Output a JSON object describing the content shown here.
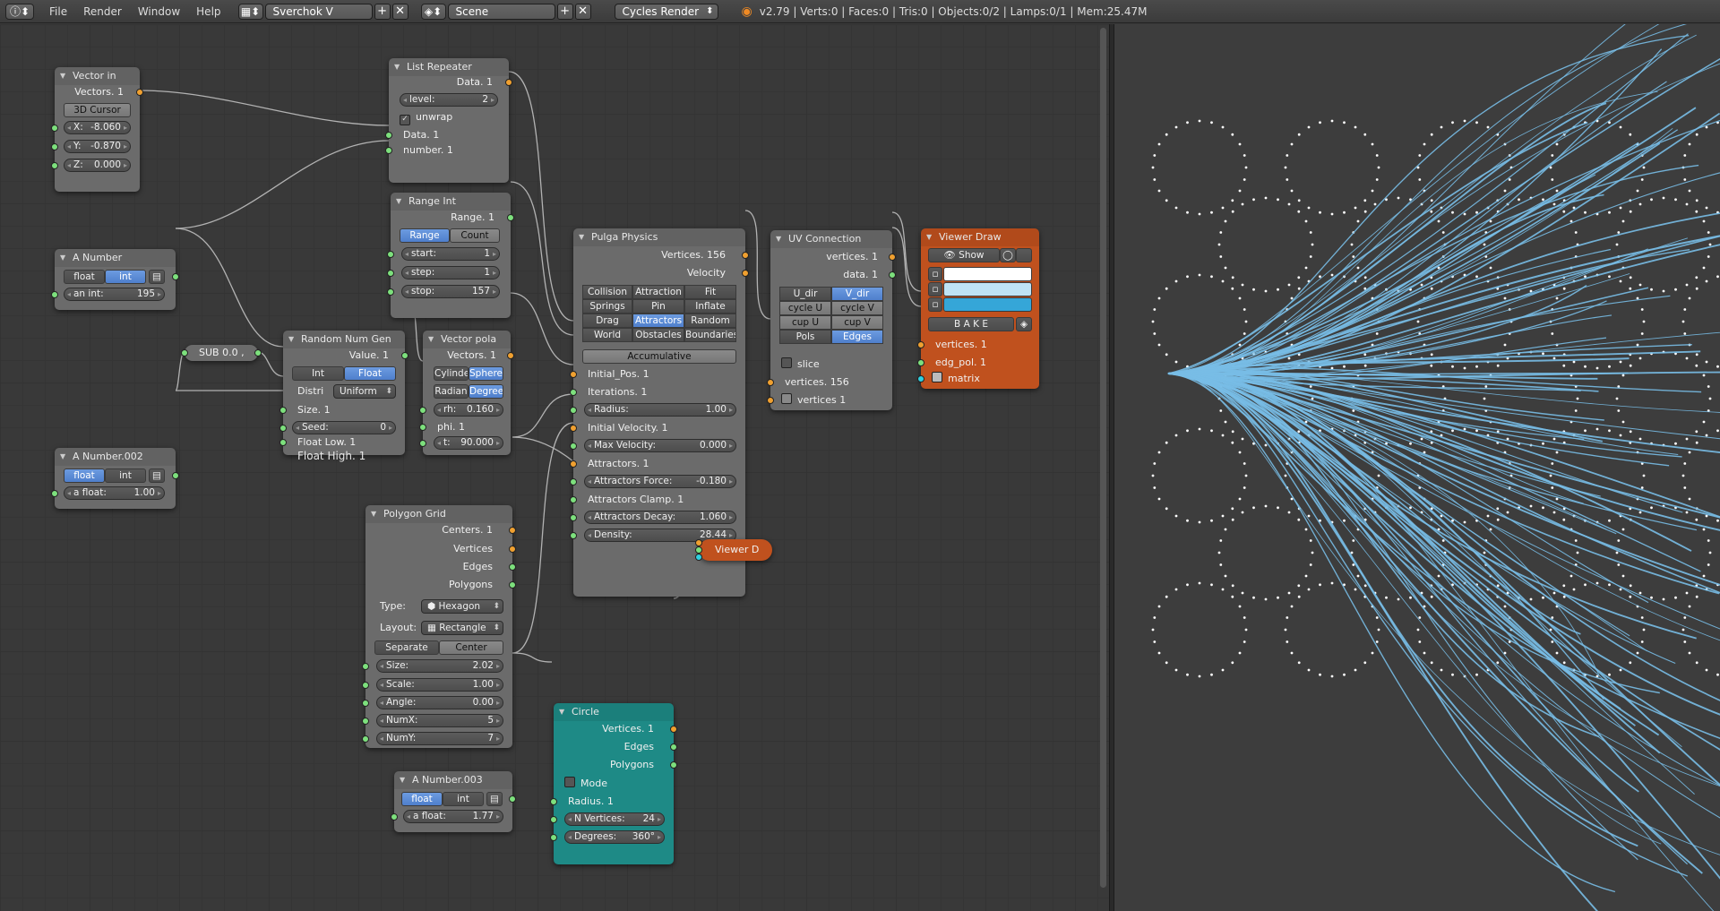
{
  "topbar": {
    "info_icon": "info-icon",
    "menus": [
      "File",
      "Render",
      "Window",
      "Help"
    ],
    "screen_name": "Sverchok V",
    "scene_name": "Scene",
    "render_engine": "Cycles Render",
    "stats": "v2.79 | Verts:0 | Faces:0 | Tris:0 | Objects:0/2 | Lamps:0/1 | Mem:25.47M"
  },
  "nodes": {
    "vector_in": {
      "title": "Vector in",
      "out_vectors": "Vectors. 1",
      "btn_cursor": "3D Cursor",
      "x_label": "X:",
      "x_val": "-8.060",
      "y_label": "Y:",
      "y_val": "-0.870",
      "z_label": "Z:",
      "z_val": "0.000"
    },
    "list_repeater": {
      "title": "List Repeater",
      "out_data": "Data. 1",
      "level_label": "level:",
      "level_val": "2",
      "unwrap": "unwrap",
      "in_data": "Data. 1",
      "in_number": "number. 1"
    },
    "range_int": {
      "title": "Range Int",
      "out_range": "Range. 1",
      "btn_range": "Range",
      "btn_count": "Count",
      "start_label": "start:",
      "start_val": "1",
      "step_label": "step:",
      "step_val": "1",
      "stop_label": "stop:",
      "stop_val": "157"
    },
    "a_number": {
      "title": "A Number",
      "btn_float": "float",
      "btn_int": "int",
      "int_label": "an int:",
      "int_val": "195"
    },
    "random_num_gen": {
      "title": "Random Num Gen",
      "out_value": "Value. 1",
      "btn_int": "Int",
      "btn_float": "Float",
      "distri_label": "Distri",
      "distri_val": "Uniform",
      "in_size": "Size. 1",
      "seed_label": "Seed:",
      "seed_val": "0",
      "in_flow": "Float Low. 1",
      "in_fhigh": "Float High. 1"
    },
    "vector_polar": {
      "title": "Vector pola",
      "out_vectors": "Vectors. 1",
      "btn_cyl": "Cylinde",
      "btn_sph": "Sphere",
      "btn_rad": "Radian",
      "btn_deg": "Degree",
      "rh_label": "rh:",
      "rh_val": "0.160",
      "in_phi": "phi. 1",
      "t_label": "t:",
      "t_val": "90.000"
    },
    "sub": {
      "title": "SUB 0.0 ,"
    },
    "a_number_002": {
      "title": "A Number.002",
      "btn_float": "float",
      "btn_int": "int",
      "float_label": "a float:",
      "float_val": "1.00"
    },
    "pulga": {
      "title": "Pulga Physics",
      "out_vertices": "Vertices. 156",
      "out_velocity": "Velocity",
      "grid": [
        "Collision",
        "Attraction",
        "Fit",
        "Springs",
        "Pin",
        "Inflate",
        "Drag",
        "Attractors",
        "Random",
        "World",
        "Obstacles",
        "Boundaries"
      ],
      "accumulative": "Accumulative",
      "in_initial_pos": "Initial_Pos. 1",
      "in_iterations": "Iterations. 1",
      "radius_label": "Radius:",
      "radius_val": "1.00",
      "in_initial_vel": "Initial Velocity. 1",
      "maxvel_label": "Max Velocity:",
      "maxvel_val": "0.000",
      "in_attractors": "Attractors. 1",
      "attforce_label": "Attractors Force:",
      "attforce_val": "-0.180",
      "in_attclamp": "Attractors Clamp. 1",
      "attdecay_label": "Attractors Decay:",
      "attdecay_val": "1.060",
      "density_label": "Density:",
      "density_val": "28.44"
    },
    "uv_connection": {
      "title": "UV Connection",
      "out_vertices": "vertices. 1",
      "out_data": "data. 1",
      "grid": [
        "U_dir",
        "V_dir",
        "cycle U",
        "cycle V",
        "cup U",
        "cup V",
        "Pols",
        "Edges"
      ],
      "slice": "slice",
      "in_vertices": "vertices. 156",
      "in_vertices1": "vertices 1"
    },
    "viewer_draw": {
      "title": "Viewer Draw",
      "btn_show": "Show",
      "btn_bake": "B A K E",
      "in_vertices": "vertices. 1",
      "in_edgpol": "edg_pol. 1",
      "in_matrix": "matrix",
      "color_vert": "#ffffff",
      "color_edge": "#bfe3f5",
      "color_face": "#35a6d8"
    },
    "polygon_grid": {
      "title": "Polygon Grid",
      "out_centers": "Centers. 1",
      "out_vertices": "Vertices",
      "out_edges": "Edges",
      "out_polygons": "Polygons",
      "type_label": "Type:",
      "type_val": "Hexagon",
      "layout_label": "Layout:",
      "layout_val": "Rectangle",
      "btn_separate": "Separate",
      "btn_center": "Center",
      "size_label": "Size:",
      "size_val": "2.02",
      "scale_label": "Scale:",
      "scale_val": "1.00",
      "angle_label": "Angle:",
      "angle_val": "0.00",
      "numx_label": "NumX:",
      "numx_val": "5",
      "numy_label": "NumY:",
      "numy_val": "7"
    },
    "viewer_d": {
      "title": "Viewer D"
    },
    "circle": {
      "title": "Circle",
      "out_vertices": "Vertices. 1",
      "out_edges": "Edges",
      "out_polygons": "Polygons",
      "mode": "Mode",
      "in_radius": "Radius. 1",
      "nverts_label": "N Vertices:",
      "nverts_val": "24",
      "degrees_label": "Degrees:",
      "degrees_val": "360°"
    },
    "a_number_003": {
      "title": "A Number.003",
      "btn_float": "float",
      "btn_int": "int",
      "float_label": "a float:",
      "float_val": "1.77"
    }
  },
  "viewport": {
    "point_color": "#ffffff",
    "curve_color": "#78bde6",
    "background": "#3d3d3d"
  }
}
